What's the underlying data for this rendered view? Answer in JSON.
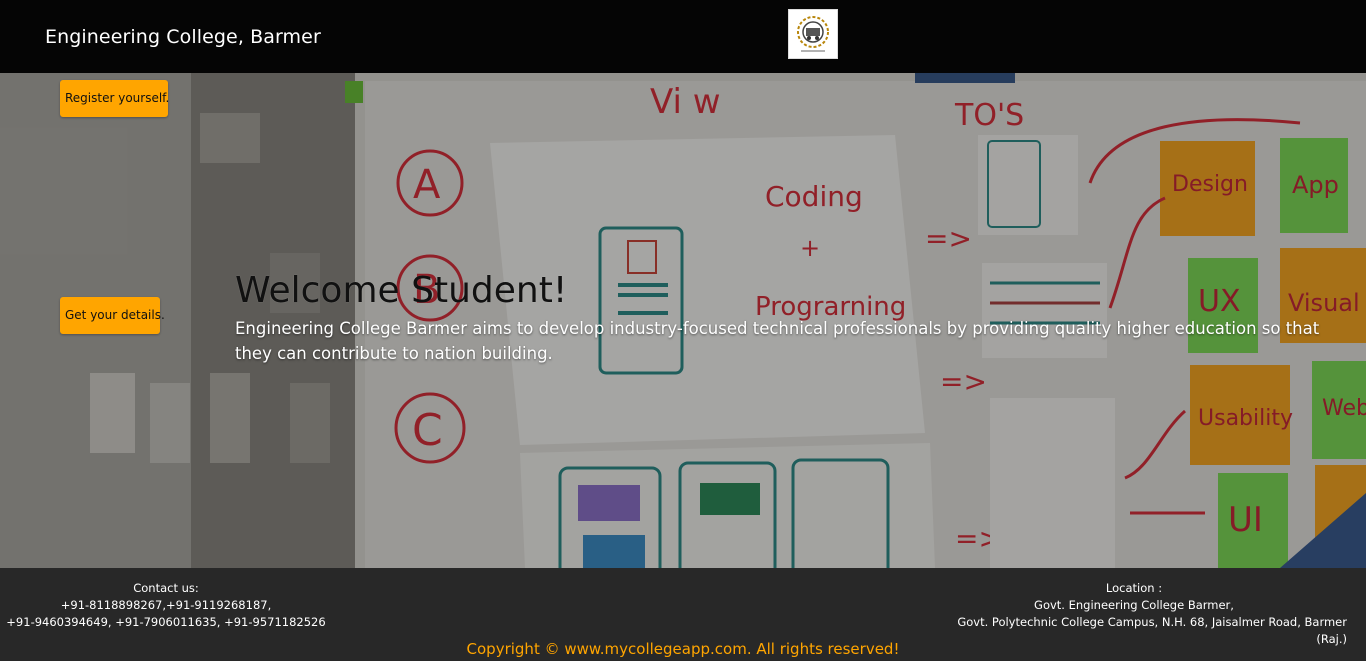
{
  "header": {
    "brand": "Engineering College, Barmer",
    "logo_icon": "college-emblem-icon"
  },
  "sidebar": {
    "register_label": "Register yourself.",
    "details_label": "Get your details."
  },
  "hero": {
    "title": "Welcome Student!",
    "description": "Engineering College Barmer aims to develop industry-focused technical professionals by providing quality higher education so that they can contribute to nation building."
  },
  "footer": {
    "contact_title": "Contact us:",
    "contact_line1": "+91-8118898267,+91-9119268187,",
    "contact_line2": "+91-9460394649, +91-7906011635, +91-9571182526",
    "location_title": "Location :",
    "location_line1": "Govt. Engineering College Barmer,",
    "location_line2": "Govt. Polytechnic College Campus, N.H. 68, Jaisalmer Road, Barmer (Raj.)",
    "copyright": "Copyright © www.mycollegeapp.com. All rights reserved!"
  },
  "colors": {
    "accent": "#ffa500",
    "header_bg": "#050505",
    "footer_bg": "#282828"
  }
}
